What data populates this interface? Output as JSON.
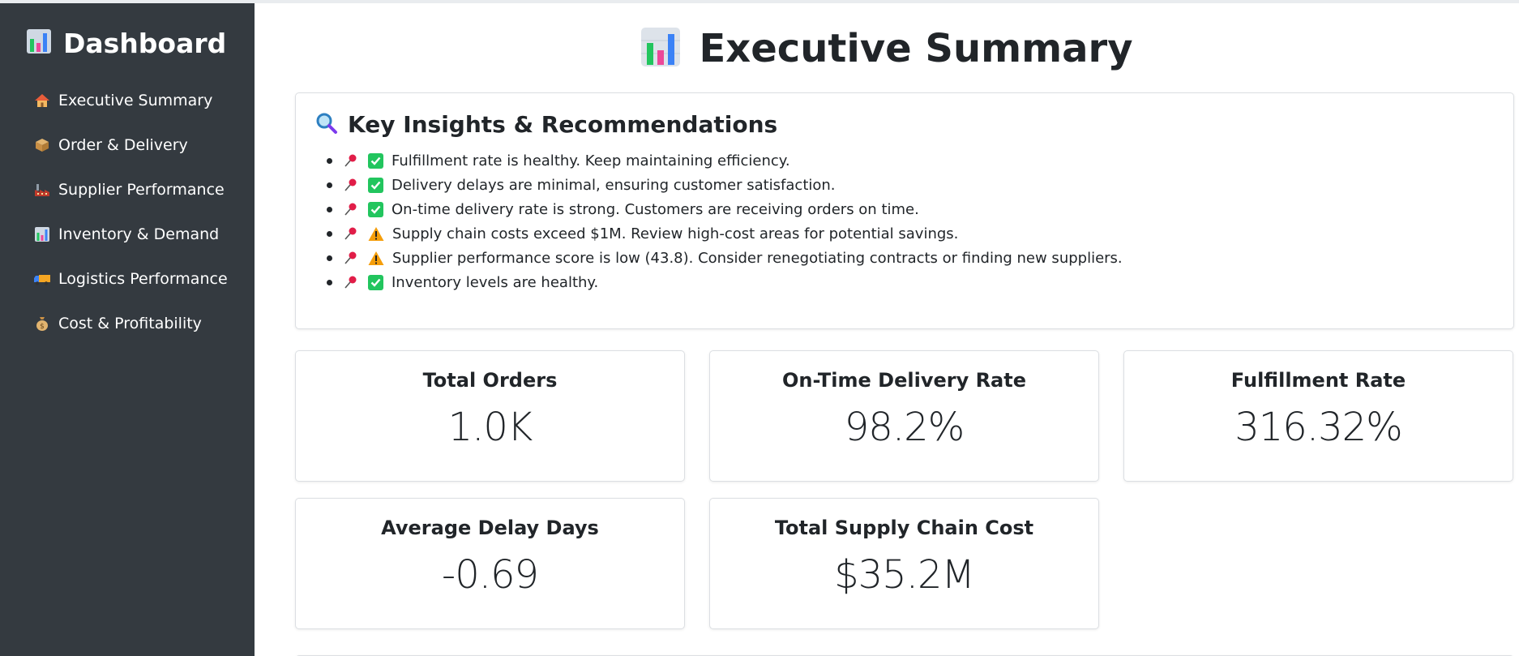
{
  "sidebar": {
    "brand_title": "Dashboard",
    "brand_icon": "bar-chart-icon",
    "items": [
      {
        "label": "Executive Summary",
        "icon": "house-icon"
      },
      {
        "label": "Order & Delivery",
        "icon": "package-icon"
      },
      {
        "label": "Supplier Performance",
        "icon": "factory-icon"
      },
      {
        "label": "Inventory & Demand",
        "icon": "bar-chart-icon"
      },
      {
        "label": "Logistics Performance",
        "icon": "truck-icon"
      },
      {
        "label": "Cost & Profitability",
        "icon": "money-bag-icon"
      }
    ]
  },
  "page": {
    "title": "Executive Summary",
    "icon": "bar-chart-icon"
  },
  "insights": {
    "title": "Key Insights & Recommendations",
    "icon": "magnifier-icon",
    "items": [
      {
        "status": "check",
        "text": "Fulfillment rate is healthy. Keep maintaining efficiency."
      },
      {
        "status": "check",
        "text": "Delivery delays are minimal, ensuring customer satisfaction."
      },
      {
        "status": "check",
        "text": "On-time delivery rate is strong. Customers are receiving orders on time."
      },
      {
        "status": "warning",
        "text": "Supply chain costs exceed $1M. Review high-cost areas for potential savings."
      },
      {
        "status": "warning",
        "text": "Supplier performance score is low (43.8). Consider renegotiating contracts or finding new suppliers."
      },
      {
        "status": "check",
        "text": "Inventory levels are healthy."
      }
    ]
  },
  "kpis": [
    {
      "label": "Total Orders",
      "value": "1.0K"
    },
    {
      "label": "On-Time Delivery Rate",
      "value": "98.2%"
    },
    {
      "label": "Fulfillment Rate",
      "value": "316.32%"
    },
    {
      "label": "Average Delay Days",
      "value": "-0.69"
    },
    {
      "label": "Total Supply Chain Cost",
      "value": "$35.2M"
    }
  ],
  "colors": {
    "sidebar_bg": "#343a40",
    "check_green": "#22c55e",
    "warning_yellow": "#f59e0b",
    "pin_red": "#e11d48"
  }
}
